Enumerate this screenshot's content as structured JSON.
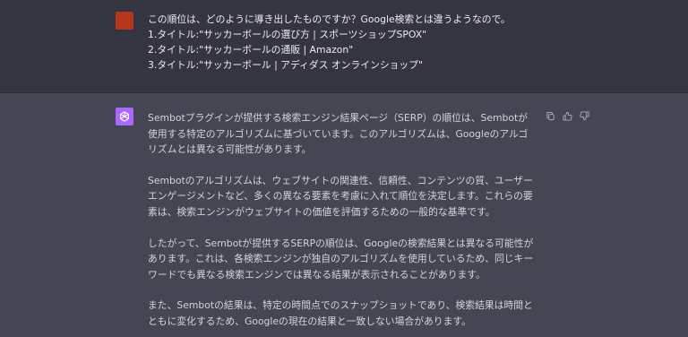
{
  "user_message": {
    "lines": [
      "この順位は、どのように導き出したものですか？Google検索とは違うようなので。",
      "1.タイトル:\"サッカーボールの選び方 | スポーツショップSPOX\"",
      "2.タイトル:\"サッカーボールの通販 | Amazon\"",
      "3.タイトル:\"サッカーボール | アディダス オンラインショップ\""
    ],
    "avatar_color": "#b5361a"
  },
  "assistant_message": {
    "avatar_icon": "openai-logo-icon",
    "avatar_color": "#ab68ff",
    "paragraphs": [
      "Sembotプラグインが提供する検索エンジン結果ページ（SERP）の順位は、Sembotが使用する特定のアルゴリズムに基づいています。このアルゴリズムは、Googleのアルゴリズムとは異なる可能性があります。",
      "Sembotのアルゴリズムは、ウェブサイトの関連性、信頼性、コンテンツの質、ユーザーエンゲージメントなど、多くの異なる要素を考慮に入れて順位を決定します。これらの要素は、検索エンジンがウェブサイトの価値を評価するための一般的な基準です。",
      "したがって、Sembotが提供するSERPの順位は、Googleの検索結果とは異なる可能性があります。これは、各検索エンジンが独自のアルゴリズムを使用しているため、同じキーワードでも異なる検索エンジンでは異なる結果が表示されることがあります。",
      "また、Sembotの結果は、特定の時間点でのスナップショットであり、検索結果は時間とともに変化するため、Googleの現在の結果と一致しない場合があります。"
    ],
    "actions": [
      "copy-icon",
      "thumbs-up-icon",
      "thumbs-down-icon"
    ]
  }
}
